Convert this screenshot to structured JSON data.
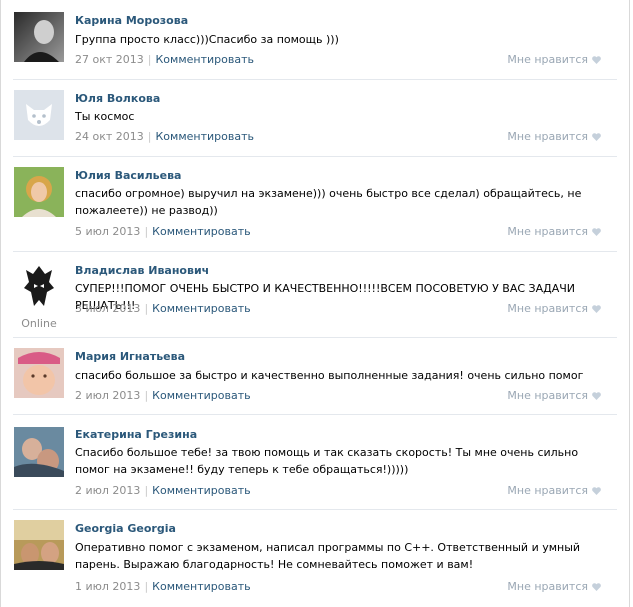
{
  "posts": [
    {
      "name": "Карина Морозова",
      "text": "Группа просто класс)))Спасибо за помощь )))",
      "date": "27 окт 2013",
      "comment": "Комментировать",
      "like": "Мне нравится",
      "online": "",
      "avatar": "avatar-photo"
    },
    {
      "name": "Юля Волкова",
      "text": "Ты космос",
      "date": "24 окт 2013",
      "comment": "Комментировать",
      "like": "Мне нравится",
      "online": "",
      "avatar": "default-dog-avatar"
    },
    {
      "name": "Юлия Васильева",
      "text": "спасибо огромное) выручил на экзамене))) очень быстро все сделал) обращайтесь, не пожалеете)) не развод))",
      "date": "5 июл 2013",
      "comment": "Комментировать",
      "like": "Мне нравится",
      "online": "",
      "avatar": "avatar-photo"
    },
    {
      "name": "Владислав Иванович",
      "text": "СУПЕР!!!ПОМОГ ОЧЕНЬ БЫСТРО И КАЧЕСТВЕННО!!!!!ВСЕМ ПОСОВЕТУЮ У ВАС ЗАДАЧИ РЕШАТЬ!!!",
      "date": "3 июл 2013",
      "comment": "Комментировать",
      "like": "Мне нравится",
      "online": "Online",
      "avatar": "tribal-mask-avatar"
    },
    {
      "name": "Мария Игнатьева",
      "text": "спасибо большое за быстро и качественно выполненные задания! очень сильно помог",
      "date": "2 июл 2013",
      "comment": "Комментировать",
      "like": "Мне нравится",
      "online": "",
      "avatar": "avatar-photo"
    },
    {
      "name": "Екатерина Грезина",
      "text": "Спасибо большое тебе! за твою помощь и так сказать скорость! Ты мне очень сильно помог на экзамене!! буду теперь к тебе обращаться!)))))",
      "date": "2 июл 2013",
      "comment": "Комментировать",
      "like": "Мне нравится",
      "online": "",
      "avatar": "avatar-photo"
    },
    {
      "name": "Georgia Georgia",
      "text": "Оперативно помог с экзаменом, написал программы по С++. Ответственный и умный парень. Выражаю благодарность! Не сомневайтесь поможет и вам!",
      "date": "1 июл 2013",
      "comment": "Комментировать",
      "like": "Мне нравится",
      "online": "",
      "avatar": "avatar-photo"
    }
  ],
  "colors": {
    "name": "#2b587a",
    "meta": "#8c8c8c",
    "like": "#9aa7b4",
    "divider": "#e4e8ed"
  }
}
